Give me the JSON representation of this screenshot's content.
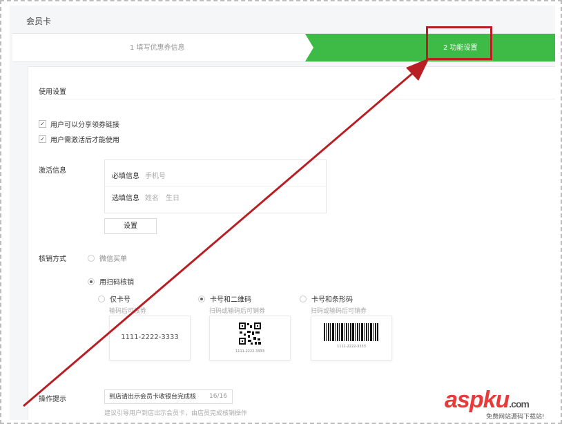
{
  "page": {
    "title": "会员卡"
  },
  "steps": [
    {
      "label": "1 填写优惠券信息",
      "active": false
    },
    {
      "label": "2 功能设置",
      "active": true
    }
  ],
  "usage": {
    "title": "使用设置",
    "options": [
      {
        "label": "用户可以分享领券链接",
        "checked": true
      },
      {
        "label": "用户需激活后才能使用",
        "checked": true
      }
    ]
  },
  "activation": {
    "label": "激活信息",
    "required_label": "必填信息",
    "required_values": "手机号",
    "optional_label": "选填信息",
    "optional_values": "姓名　生日",
    "settings_button": "设置"
  },
  "verify": {
    "label": "核销方式",
    "methods": [
      {
        "label": "微信买单",
        "selected": false
      },
      {
        "label": "用扫码核销",
        "selected": true
      }
    ],
    "code_types": [
      {
        "label": "仅卡号",
        "hint": "输码后可核券",
        "sample": "1111-2222-3333",
        "selected": false
      },
      {
        "label": "卡号和二维码",
        "hint": "扫码或输码后可销券",
        "sample": "1111-2222-3333",
        "selected": true
      },
      {
        "label": "卡号和条形码",
        "hint": "扫码或输码后可销券",
        "sample": "1111-2222-3333",
        "selected": false
      }
    ]
  },
  "operation_tip": {
    "label": "操作提示",
    "value": "到店请出示会员卡收银台完成核",
    "count": "16/16",
    "hint": "建议引导用户到店出示会员卡，由店员完成核销操作"
  },
  "annotations": {
    "color": "#b81f24",
    "highlight_target": "2 功能设置"
  },
  "watermark": {
    "brand_asp": "asp",
    "brand_ku": "ku",
    "brand_com": ".com",
    "tagline": "免费网站源码下载站!"
  },
  "colors": {
    "accent": "#3dbb46",
    "annotation": "#b81f24"
  }
}
